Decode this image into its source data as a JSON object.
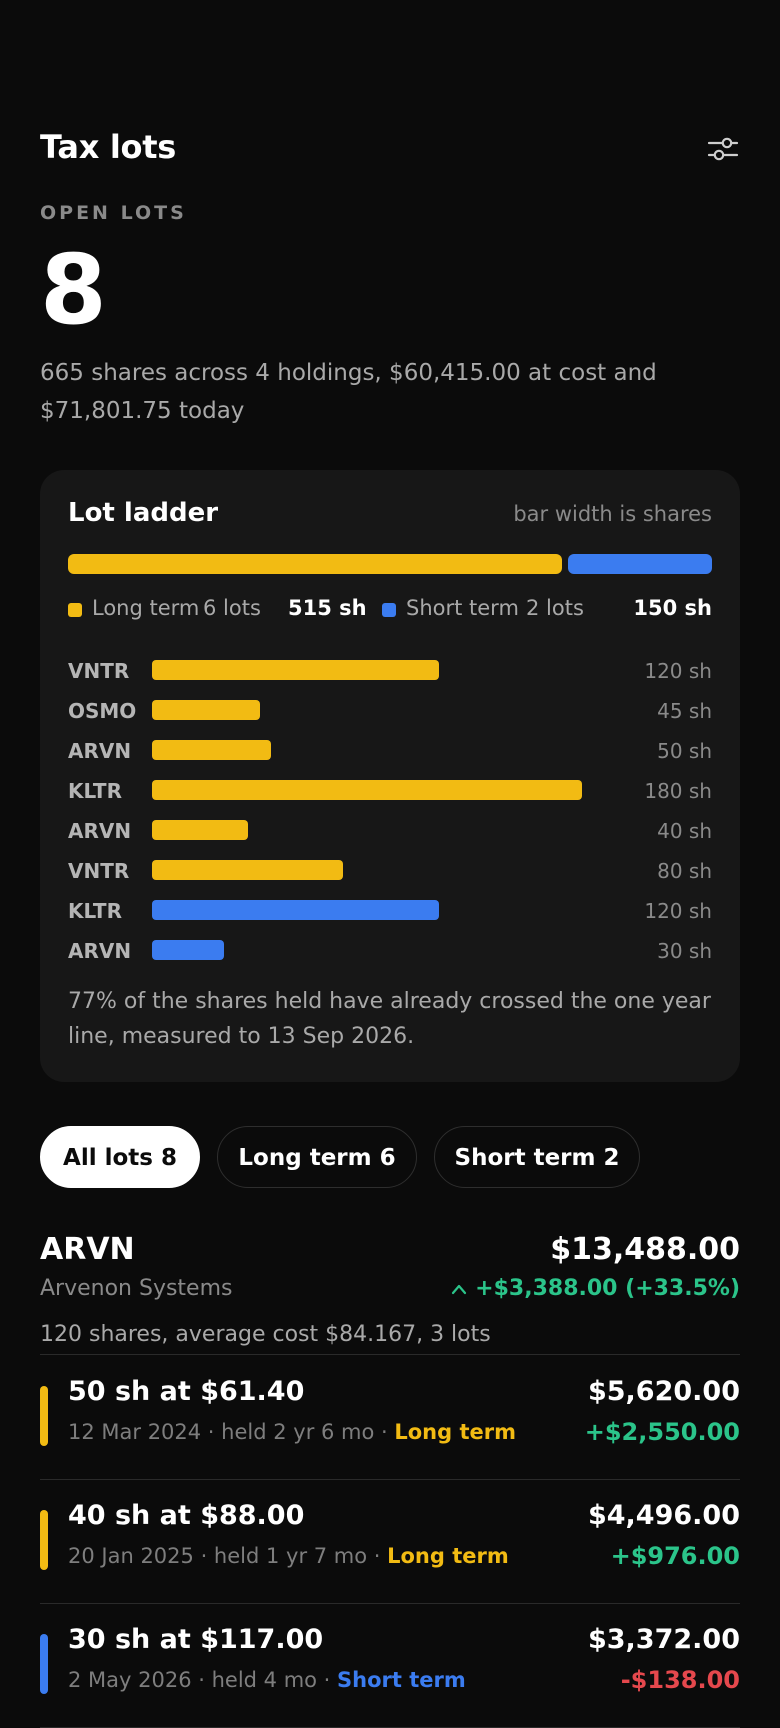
{
  "header": {
    "title": "Tax lots",
    "filter_icon": "sliders-icon"
  },
  "overview": {
    "overline": "OPEN LOTS",
    "count": "8",
    "summary": "665 shares across 4 holdings, $60,415.00 at cost and $71,801.75 today"
  },
  "ladder_card": {
    "title": "Lot ladder",
    "hint": "bar width is shares",
    "totals": {
      "long_shares": 515,
      "short_shares": 150,
      "total_shares": 665
    },
    "legend": {
      "long_label": "Long term",
      "long_lots": "6 lots",
      "long_sh": "515 sh",
      "short_label": "Short term",
      "short_lots": "2 lots",
      "short_sh": "150 sh"
    },
    "rows": [
      {
        "ticker": "VNTR",
        "shares": 120,
        "shares_label": "120 sh",
        "term": "long"
      },
      {
        "ticker": "OSMO",
        "shares": 45,
        "shares_label": "45 sh",
        "term": "long"
      },
      {
        "ticker": "ARVN",
        "shares": 50,
        "shares_label": "50 sh",
        "term": "long"
      },
      {
        "ticker": "KLTR",
        "shares": 180,
        "shares_label": "180 sh",
        "term": "long"
      },
      {
        "ticker": "ARVN",
        "shares": 40,
        "shares_label": "40 sh",
        "term": "long"
      },
      {
        "ticker": "VNTR",
        "shares": 80,
        "shares_label": "80 sh",
        "term": "long"
      },
      {
        "ticker": "KLTR",
        "shares": 120,
        "shares_label": "120 sh",
        "term": "short"
      },
      {
        "ticker": "ARVN",
        "shares": 30,
        "shares_label": "30 sh",
        "term": "short"
      }
    ],
    "note": "77% of the shares held have already crossed the one year line, measured to 13 Sep 2026."
  },
  "filters": [
    {
      "label": "All lots 8",
      "active": true
    },
    {
      "label": "Long term 6",
      "active": false
    },
    {
      "label": "Short term 2",
      "active": false
    }
  ],
  "holding": {
    "ticker": "ARVN",
    "name": "Arvenon Systems",
    "value": "$13,488.00",
    "gain": "+$3,388.00 (+33.5%)",
    "meta": "120 shares, average cost $84.167, 3 lots",
    "lots": [
      {
        "title": "50 sh at $61.40",
        "date": "12 Mar 2024 · held 2 yr 6 mo · ",
        "term_label": "Long term",
        "term": "long",
        "value": "$5,620.00",
        "pl": "+$2,550.00",
        "pl_sign": "pos"
      },
      {
        "title": "40 sh at $88.00",
        "date": "20 Jan 2025 · held 1 yr 7 mo · ",
        "term_label": "Long term",
        "term": "long",
        "value": "$4,496.00",
        "pl": "+$976.00",
        "pl_sign": "pos"
      },
      {
        "title": "30 sh at $117.00",
        "date": "2 May 2026 · held 4 mo · ",
        "term_label": "Short term",
        "term": "short",
        "value": "$3,372.00",
        "pl": "-$138.00",
        "pl_sign": "neg"
      }
    ]
  },
  "colors": {
    "long": "#f2bb13",
    "short": "#3b7cf0",
    "gain": "#2bc48a",
    "loss": "#e5484d"
  }
}
